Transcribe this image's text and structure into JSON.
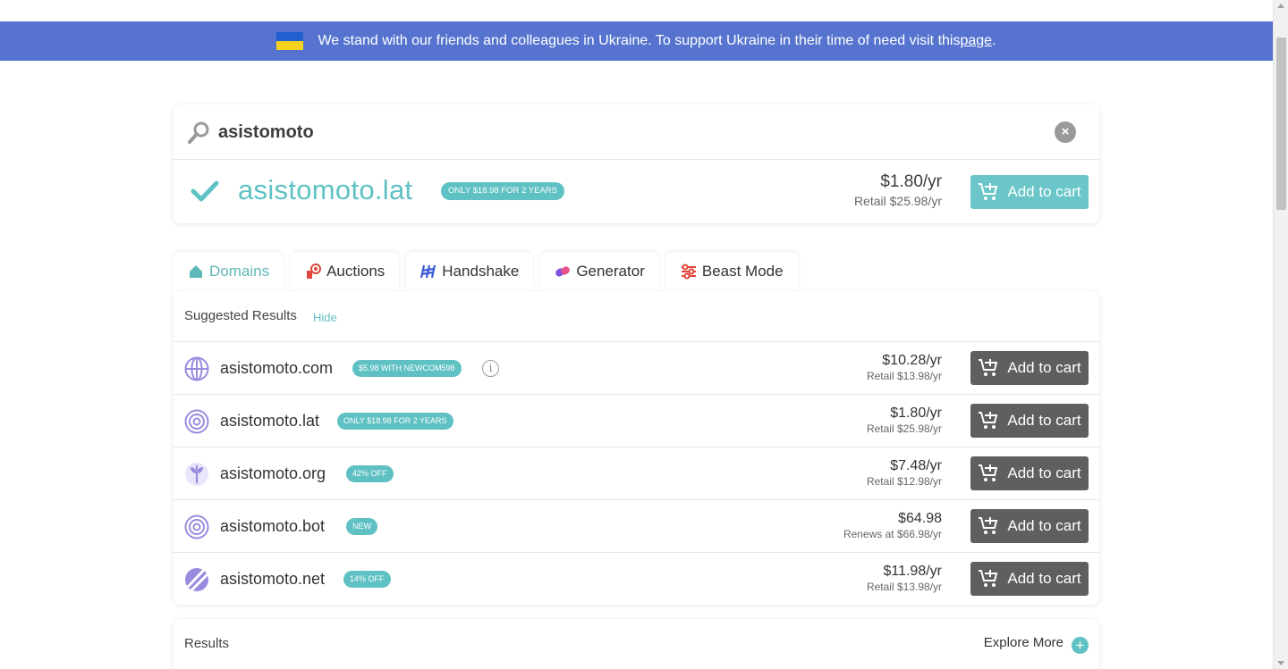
{
  "banner": {
    "text": "We stand with our friends and colleagues in Ukraine. To support Ukraine in their time of need visit this ",
    "link": "page",
    "period": "."
  },
  "search": {
    "value": "asistomoto",
    "clear_label": "×"
  },
  "featured": {
    "domain": "asistomoto.lat",
    "badge": "ONLY $18.98 FOR 2 YEARS",
    "price": "$1.80/yr",
    "retail": "Retail $25.98/yr",
    "cart_label": "Add to cart"
  },
  "tabs": [
    {
      "label": "Domains"
    },
    {
      "label": "Auctions"
    },
    {
      "label": "Handshake"
    },
    {
      "label": "Generator"
    },
    {
      "label": "Beast Mode"
    }
  ],
  "suggested": {
    "title": "Suggested Results",
    "hide_label": "Hide",
    "rows": [
      {
        "domain": "asistomoto.com",
        "badge": "$5.98 WITH NEWCOM598",
        "price": "$10.28/yr",
        "sub": "Retail $13.98/yr",
        "cart_label": "Add to cart",
        "icon": "globe-icon",
        "info": "i"
      },
      {
        "domain": "asistomoto.lat",
        "badge": "ONLY $18.98 FOR 2 YEARS",
        "price": "$1.80/yr",
        "sub": "Retail $25.98/yr",
        "cart_label": "Add to cart",
        "icon": "target-icon"
      },
      {
        "domain": "asistomoto.org",
        "badge": "42% OFF",
        "price": "$7.48/yr",
        "sub": "Retail $12.98/yr",
        "cart_label": "Add to cart",
        "icon": "sprout-icon"
      },
      {
        "domain": "asistomoto.bot",
        "badge": "NEW",
        "price": "$64.98",
        "sub": "Renews at $66.98/yr",
        "cart_label": "Add to cart",
        "icon": "target-icon"
      },
      {
        "domain": "asistomoto.net",
        "badge": "14% OFF",
        "price": "$11.98/yr",
        "sub": "Retail $13.98/yr",
        "cart_label": "Add to cart",
        "icon": "net-icon"
      }
    ]
  },
  "results": {
    "title": "Results",
    "explore_label": "Explore More",
    "plus": "+"
  },
  "colors": {
    "banner_bg": "#5674cf",
    "accent_teal": "#5fc1c3",
    "dark_button": "#5f5f5f",
    "icon_purple": "#9b8be0"
  }
}
